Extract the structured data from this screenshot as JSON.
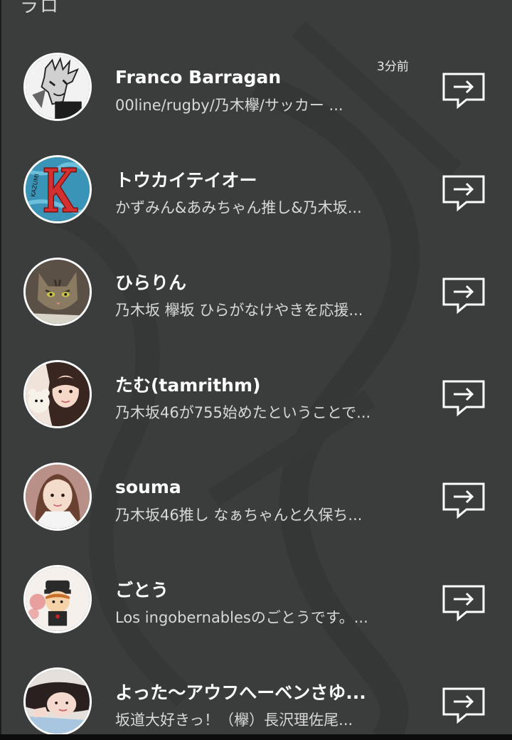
{
  "header": {
    "partial_label": "ラロ"
  },
  "users": [
    {
      "name": "Franco Barragan",
      "bio": "00line/rugby/乃木欅/サッカー ...",
      "time": "3分前",
      "avatar": "avatar-manga",
      "action_icon": "message-forward-icon"
    },
    {
      "name": "トウカイテイオー",
      "bio": "かずみん&あみちゃん推し&乃木坂...",
      "time": "",
      "avatar": "avatar-letter-k",
      "action_icon": "message-forward-icon"
    },
    {
      "name": "ひらりん",
      "bio": "乃木坂 欅坂  ひらがなけやきを応援...",
      "time": "",
      "avatar": "avatar-cat",
      "action_icon": "message-forward-icon"
    },
    {
      "name": "たむ(tamrithm)",
      "bio": "乃木坂46が755始めたということで...",
      "time": "",
      "avatar": "avatar-girl-bear",
      "action_icon": "message-forward-icon"
    },
    {
      "name": "souma",
      "bio": "乃木坂46推し なぁちゃんと久保ち...",
      "time": "",
      "avatar": "avatar-girl-selfie",
      "action_icon": "message-forward-icon"
    },
    {
      "name": "ごとう",
      "bio": "Los ingobernablesのごとうです。...",
      "time": "",
      "avatar": "avatar-cartoon",
      "action_icon": "message-forward-icon"
    },
    {
      "name": "よった〜アウフへーベンさゆ...",
      "bio": "坂道大好きっ！（欅）長沢理佐尾...",
      "time": "",
      "avatar": "avatar-girl-lying",
      "action_icon": "message-forward-icon"
    }
  ],
  "colors": {
    "background": "#3b3c3c",
    "text_primary": "#ffffff",
    "text_secondary": "#d8d8d8",
    "icon": "#ffffff"
  }
}
